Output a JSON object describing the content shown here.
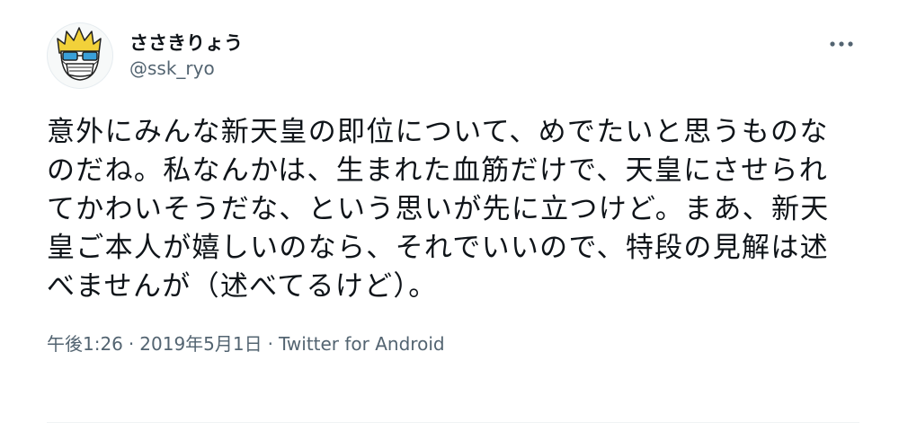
{
  "user": {
    "display_name": "ささきりょう",
    "handle": "@ssk_ryo"
  },
  "tweet": {
    "text": "意外にみんな新天皇の即位について、めでたいと思うものなのだね。私なんかは、生まれた血筋だけで、天皇にさせられてかわいそうだな、という思いが先に立つけど。まあ、新天皇ご本人が嬉しいのなら、それでいいので、特段の見解は述べませんが（述べてるけど）。",
    "time": "午後1:26",
    "date": "2019年5月1日",
    "source": "Twitter for Android",
    "separator": "·"
  },
  "icons": {
    "more": "more-dots-icon",
    "avatar": "avatar-illustration"
  },
  "colors": {
    "text": "#0f1419",
    "secondary": "#536471",
    "avatar_hair": "#f2d13a",
    "avatar_glasses": "#3aa0d9"
  }
}
